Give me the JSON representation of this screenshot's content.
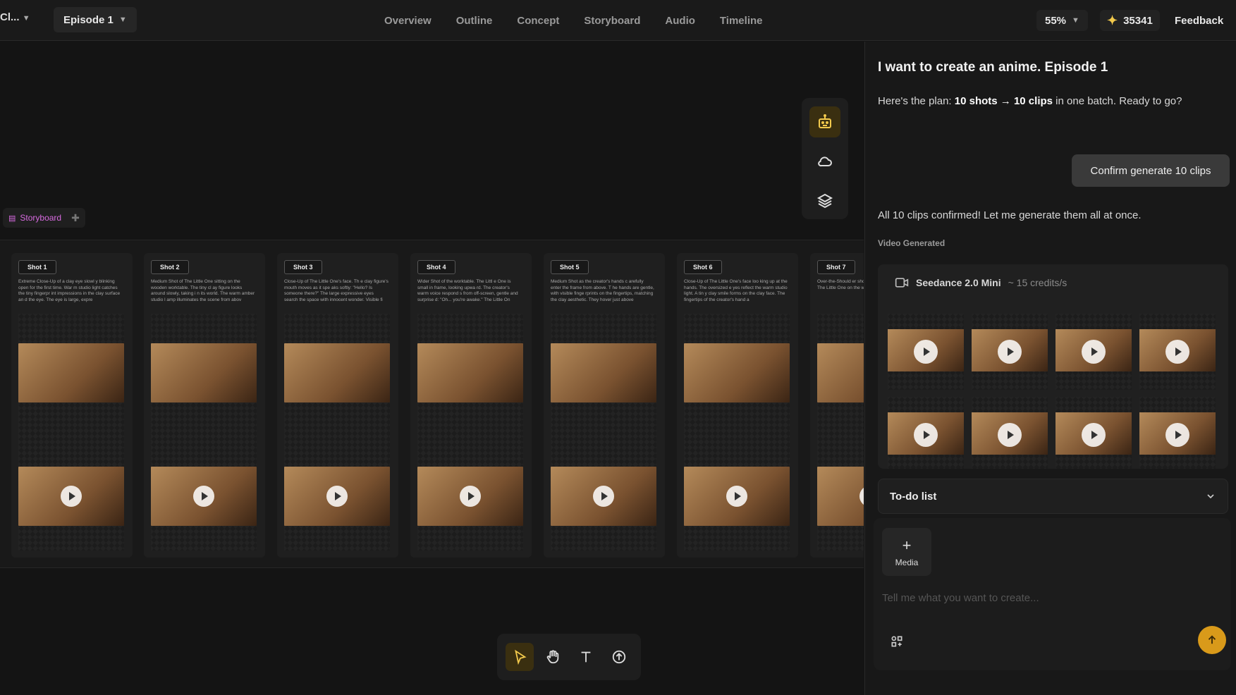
{
  "topbar": {
    "project": "Cl...",
    "episode": "Episode 1",
    "nav": [
      "Overview",
      "Outline",
      "Concept",
      "Storyboard",
      "Audio",
      "Timeline"
    ],
    "zoom": "55%",
    "credits": "35341",
    "feedback": "Feedback"
  },
  "storyboard": {
    "tab_label": "Storyboard",
    "shots": [
      {
        "label": "Shot 1",
        "desc": "Extreme Close-Up of a clay eye slowl y blinking open for the first time. War m studio light catches the tiny fingerpr int impressions in the clay surface an d the eye. The eye is large, expre"
      },
      {
        "label": "Shot 2",
        "desc": "Medium Shot of The Little One sitting on the wooden worktable. The tiny cl ay figure looks around slowly, taking i n its world. The warm amber studio l amp illuminates the scene from abov"
      },
      {
        "label": "Shot 3",
        "desc": "Close-Up of The Little One's face. Th e clay figure's mouth moves as it spe aks softly: \"Hello? Is someone there?\" The large expressive eyes search the space with innocent wonder. Visible fi"
      },
      {
        "label": "Shot 4",
        "desc": "Wider Shot of the worktable. The Littl e One is small in frame, looking upwa rd. The creator's warm voice respond s from off-screen, gentle and surprise d: \"Oh... you're awake.\" The Little On"
      },
      {
        "label": "Shot 5",
        "desc": "Medium Shot as the creator's hands c arefully enter the frame from above. T he hands are gentle, with visible finge rprints on the fingertips, matching the clay aesthetic. They hover just above"
      },
      {
        "label": "Shot 6",
        "desc": "Close-Up of The Little One's face loo king up at the hands. The oversized e yes reflect the warm studio light. A tin y clay smile forms on the clay face. The fingertips of the creator's hand a"
      },
      {
        "label": "Shot 7",
        "desc": "Over-the-Should er shot from the creator's hearts The Little One on the worktable... didn't you?\" The"
      }
    ]
  },
  "panel": {
    "title": "I want to create an anime. Episode 1",
    "plan_prefix": "Here's the plan: ",
    "plan_bold": "10 shots → 10 clips",
    "plan_suffix": " in one batch. Ready to go?",
    "confirm_button": "Confirm generate 10 clips",
    "confirmed_text": "All 10 clips confirmed! Let me generate them all at once.",
    "video_generated": "Video Generated",
    "model": "Seedance 2.0 Mini",
    "rate": "~ 15 credits/s",
    "todo": "To-do list",
    "media": "Media",
    "prompt_placeholder": "Tell me what you want to create..."
  },
  "icons": {
    "vtools": [
      "robot-icon",
      "cloud-icon",
      "layers-icon"
    ],
    "btools": [
      "pointer-icon",
      "hand-icon",
      "text-icon",
      "upload-icon"
    ]
  },
  "colors": {
    "accent": "#d99a1a",
    "storyboard_tab": "#d86be0"
  }
}
